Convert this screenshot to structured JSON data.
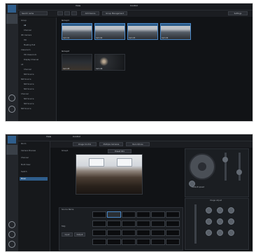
{
  "screen1": {
    "top_tabs": [
      "View",
      "Control"
    ],
    "toolbar": {
      "search_placeholder": "Search name",
      "add_device": "Add Device",
      "group_management": "Group Management",
      "settings": "Settings"
    },
    "tree": {
      "items": [
        "Group",
        "All",
        "Channel",
        "IPC Camera",
        "HD",
        "Meeting Hall",
        "Classroom",
        "HD Classroom",
        "Display Channel",
        "All",
        "Channel",
        "NDI Source",
        "NDI Source",
        "NDI Source",
        "NDI Source",
        "Channel",
        "NDI Source",
        "NDI Source",
        "NDI Source"
      ]
    },
    "groups": [
      {
        "name": "Group1",
        "thumbs": [
          "Cam 01",
          "Cam 02",
          "Cam 03",
          "Cam 04"
        ]
      },
      {
        "name": "Group2",
        "thumbs": [
          "Cam 05",
          "Cam 06"
        ]
      }
    ]
  },
  "screen2": {
    "top_tabs": [
      "View",
      "Control"
    ],
    "left_nav": [
      "Room",
      "Camera Preview",
      "Channel",
      "Multi View",
      "Switch",
      "Mixer"
    ],
    "sub_tabs": [
      "Image Control",
      "Multiple Cameras",
      "Record/Live"
    ],
    "group_label": "Group1",
    "preset_label": "Preset 001",
    "ptz_label": "Default speed",
    "right_label": "Image Adjust",
    "bottom": {
      "buttons": [
        "Input",
        "Output",
        "Preview"
      ],
      "tally": "Tally",
      "source_label": "Source Name"
    },
    "preset_cells": 24
  }
}
